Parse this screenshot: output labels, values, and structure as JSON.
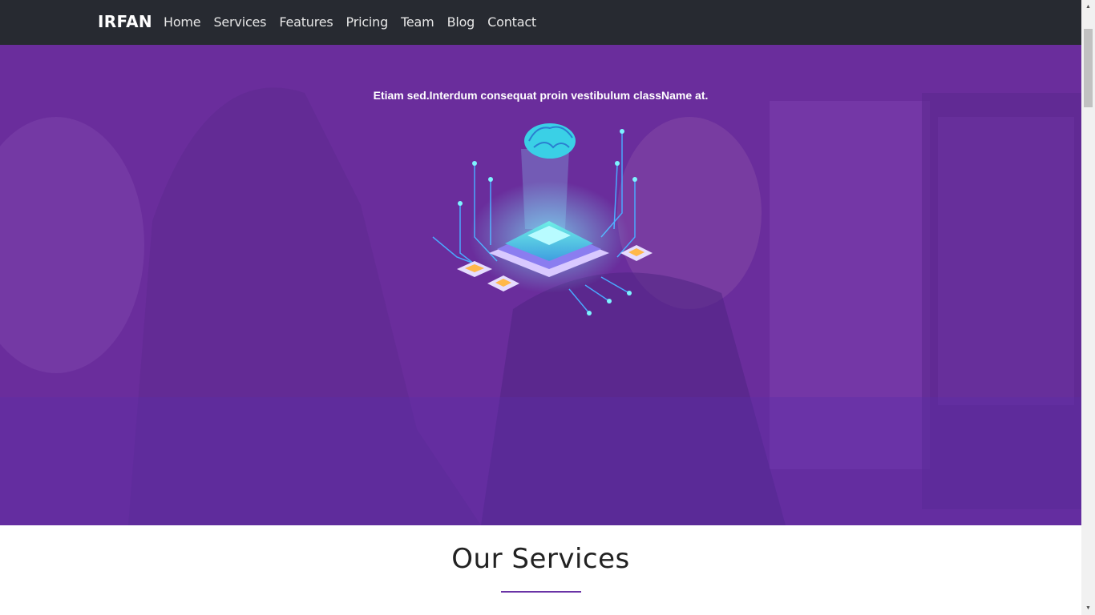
{
  "navbar": {
    "brand": "IRFAN",
    "links": [
      {
        "label": "Home"
      },
      {
        "label": "Services"
      },
      {
        "label": "Features"
      },
      {
        "label": "Pricing"
      },
      {
        "label": "Team"
      },
      {
        "label": "Blog"
      },
      {
        "label": "Contact"
      }
    ]
  },
  "hero": {
    "tagline": "Etiam sed.Interdum consequat proin vestibulum className at.",
    "illustration": "ai-brain-chip-icon"
  },
  "services": {
    "title": "Our Services"
  },
  "colors": {
    "navbar_bg": "#272a31",
    "hero_overlay": "#5e2c9e",
    "accent": "#6a33a6"
  },
  "scrollbar": {
    "up_icon": "triangle-up-icon",
    "down_icon": "triangle-down-icon"
  }
}
